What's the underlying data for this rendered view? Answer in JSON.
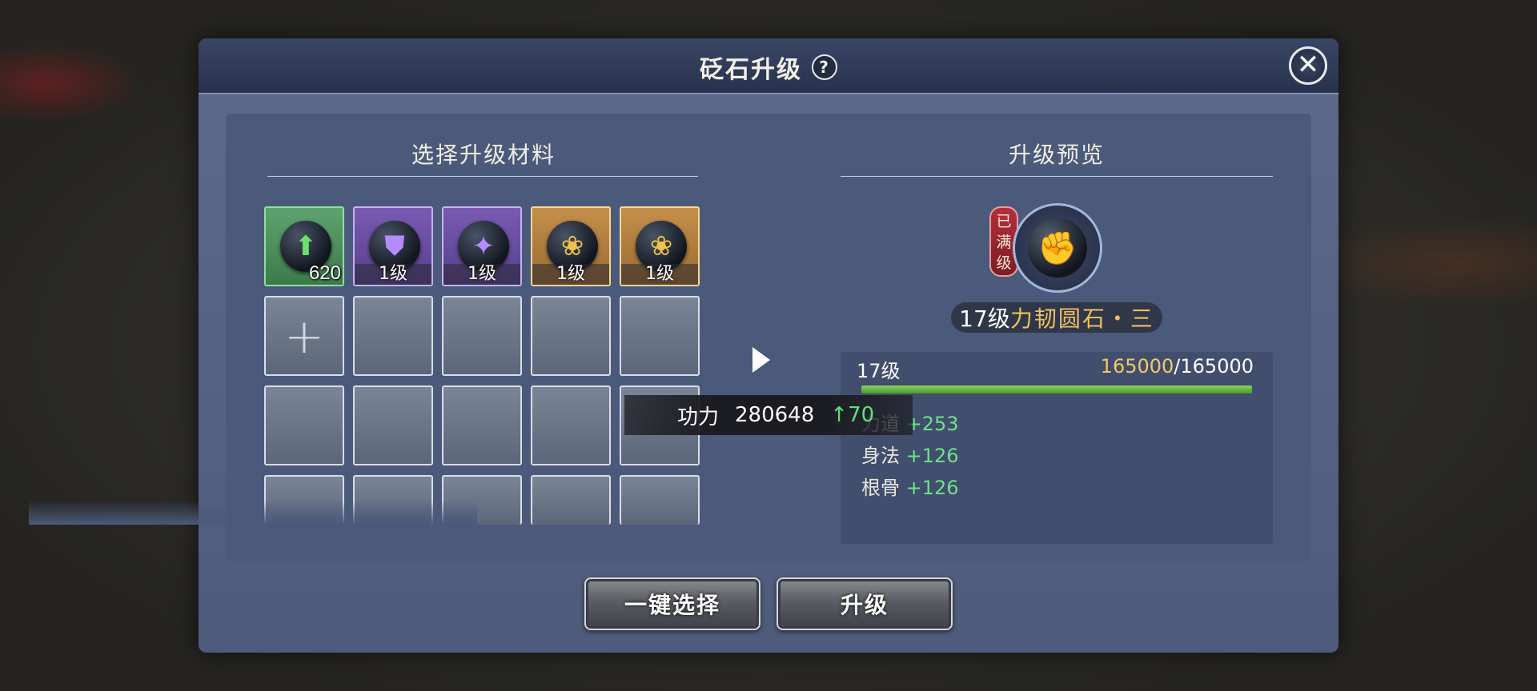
{
  "dialog": {
    "title": "砭石升级",
    "help_icon": "?",
    "close_icon": "✕"
  },
  "materials": {
    "title": "选择升级材料",
    "slots": [
      {
        "type": "green",
        "icon": "arrow-up-icon",
        "glyph": "⬆",
        "count": "620"
      },
      {
        "type": "purple",
        "icon": "shield-gem-icon",
        "glyph": "⛊",
        "level": "1级"
      },
      {
        "type": "purple",
        "icon": "bag-gem-icon",
        "glyph": "✦",
        "level": "1级"
      },
      {
        "type": "gold",
        "icon": "lotus-gem-icon",
        "glyph": "❀",
        "level": "1级"
      },
      {
        "type": "gold",
        "icon": "lotus-gem-icon",
        "glyph": "❀",
        "level": "1级"
      }
    ],
    "add_slot_icon": "+"
  },
  "preview": {
    "title": "升级预览",
    "maxed_tag": "已满级",
    "gem_glyph": "✊",
    "gem_level": "17级",
    "gem_name": "力韧圆石・三",
    "level_label": "17级",
    "exp_current": "165000",
    "exp_max": "/165000",
    "exp_fraction": 1.0,
    "stats": [
      {
        "label": "力道",
        "value": "+253"
      },
      {
        "label": "身法",
        "value": "+126"
      },
      {
        "label": "根骨",
        "value": "+126"
      }
    ]
  },
  "tooltip": {
    "label": "功力",
    "value": "280648",
    "delta": "↑70"
  },
  "buttons": {
    "auto_select": "一键选择",
    "upgrade": "升级"
  }
}
